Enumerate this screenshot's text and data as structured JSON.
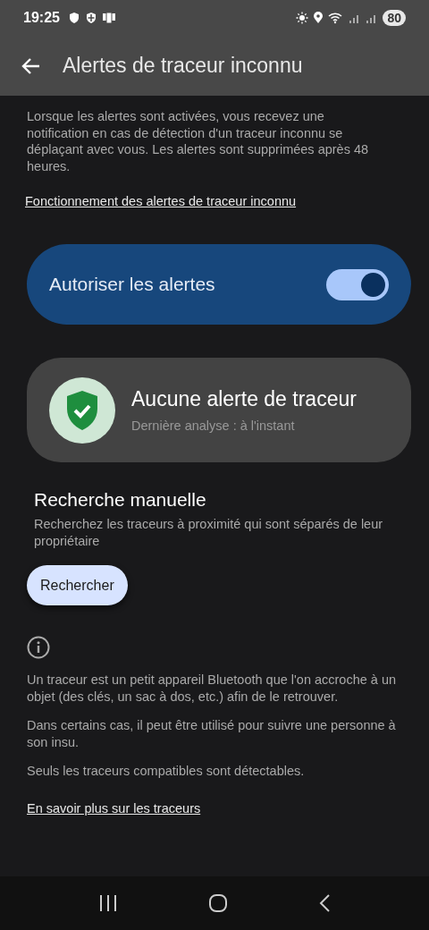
{
  "status_bar": {
    "time": "19:25",
    "battery": "80"
  },
  "header": {
    "title": "Alertes de traceur inconnu"
  },
  "intro": {
    "text": "Lorsque les alertes sont activées, vous recevez une notification en cas de détection d'un traceur inconnu se déplaçant avec vous. Les alertes sont supprimées après 48 heures.",
    "link": "Fonctionnement des alertes de traceur inconnu"
  },
  "alerts_toggle": {
    "label": "Autoriser les alertes",
    "on": true
  },
  "status_card": {
    "title": "Aucune alerte de traceur",
    "subtitle": "Dernière analyse : à l'instant"
  },
  "manual_scan": {
    "heading": "Recherche manuelle",
    "description": "Recherchez les traceurs à proximité qui sont séparés de leur propriétaire",
    "button": "Rechercher"
  },
  "info": {
    "paragraphs": [
      "Un traceur est un petit appareil Bluetooth que l'on accroche à un objet (des clés, un sac à dos, etc.) afin de le retrouver.",
      "Dans certains cas, il peut être utilisé pour suivre une personne à son insu.",
      "Seuls les traceurs compatibles sont détectables."
    ],
    "link": "En savoir plus sur les traceurs"
  }
}
